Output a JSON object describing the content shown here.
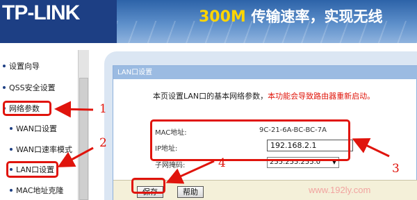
{
  "header": {
    "logo": "TP-LINK",
    "slogan_prefix": "300M",
    "slogan_text": "传输速率，实现无线"
  },
  "sidebar": {
    "items": [
      {
        "label": "设置向导"
      },
      {
        "label": "QSS安全设置"
      },
      {
        "label": "网络参数"
      },
      {
        "label": "WAN口设置"
      },
      {
        "label": "WAN口速率模式"
      },
      {
        "label": "LAN口设置"
      },
      {
        "label": "MAC地址克隆"
      }
    ]
  },
  "panel": {
    "title": "LAN口设置",
    "description": "本页设置LAN口的基本网络参数，",
    "warning": "本功能会导致路由器重新启动。",
    "mac_label": "MAC地址:",
    "mac_value": "9C-21-6A-BC-BC-7A",
    "ip_label": "IP地址:",
    "ip_value": "192.168.2.1",
    "mask_label": "子网掩码:",
    "mask_value": "255.255.255.0",
    "save_label": "保存",
    "help_label": "帮助"
  },
  "annotations": {
    "n1": "1",
    "n2": "2",
    "n3": "3",
    "n4": "4",
    "color": "#e0140c"
  },
  "watermark": "www.192ly.com",
  "colors": {
    "header_bg": "#1d3f84",
    "panel_header_bg": "#9bbbe2",
    "content_bg": "#dbe6f3",
    "button_bar_bg": "#f4f0d9"
  }
}
